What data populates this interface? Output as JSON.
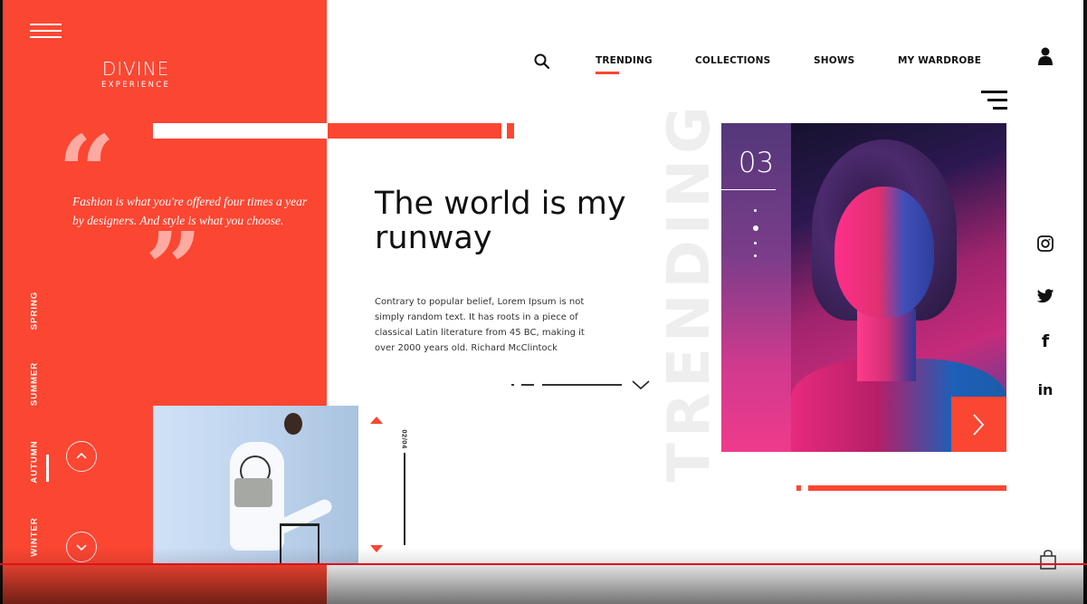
{
  "brand": {
    "name": "DIVINE",
    "tagline": "EXPERIENCE"
  },
  "nav": {
    "links": [
      "TRENDING",
      "COLLECTIONS",
      "SHOWS",
      "MY WARDROBE"
    ],
    "active": "TRENDING"
  },
  "quote": {
    "text": "Fashion is what you're offered four times a year by designers. And style is what you choose."
  },
  "seasons": [
    "SPRING",
    "SUMMER",
    "AUTUMN",
    "WINTER"
  ],
  "active_season": "AUTUMN",
  "hero": {
    "headline": "The world is my runway",
    "body": "Contrary to popular belief, Lorem Ipsum is not simply random text. It has roots in a piece of classical Latin literature from 45 BC, making it over 2000 years old. Richard McClintock"
  },
  "slider": {
    "counter": "02/04"
  },
  "feature": {
    "watermark": "TRENDING",
    "number": "03"
  },
  "social": [
    "instagram",
    "twitter",
    "facebook",
    "linkedin"
  ],
  "colors": {
    "accent": "#fb4632",
    "text": "#111111",
    "background": "#ffffff"
  },
  "icons": {
    "menu": "hamburger-icon",
    "search": "search-icon",
    "user": "user-icon",
    "cart": "shopping-bag-icon"
  }
}
